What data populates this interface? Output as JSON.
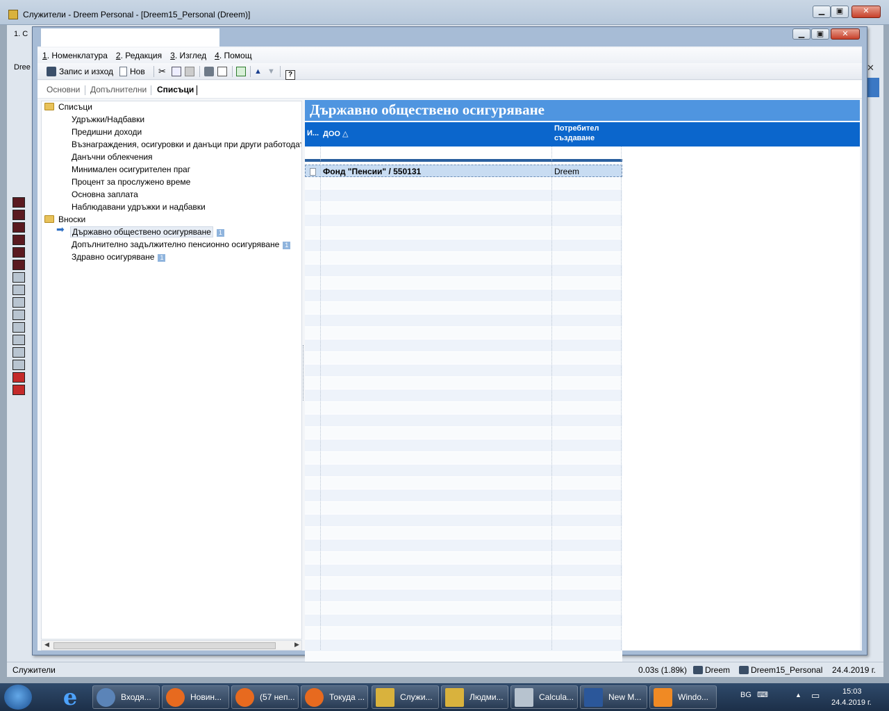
{
  "outer_window": {
    "title": "Служители - Dreem Personal - [Dreem15_Personal (Dreem)]",
    "ghost_menu_1": "1. С",
    "ghost_label": "Dree",
    "status": {
      "left": "Служители",
      "timing": "0.03s (1.89k)",
      "user": "Dreem",
      "database": "Dreem15_Personal",
      "date": "24.4.2019 г."
    }
  },
  "window_buttons": {
    "minimize": "▁",
    "maximize": "▣",
    "close": "✕"
  },
  "inner_window": {
    "menu": [
      {
        "num": "1",
        "label": ". Номенклатура"
      },
      {
        "num": "2",
        "label": ". Редакция"
      },
      {
        "num": "3",
        "label": ". Изглед"
      },
      {
        "num": "4",
        "label": ". Помощ"
      }
    ],
    "toolbar": {
      "save_exit": "Запис и изход",
      "new": "Нов"
    },
    "tabs": [
      "Основни",
      "Допълнителни",
      "Списъци"
    ],
    "tree": {
      "root_lists": "Списъци",
      "lists_items": [
        "Удръжки/Надбавки",
        "Предишни доходи",
        "Възнаграждения, осигуровки и данъци при други работодат",
        "Данъчни облекчения",
        "Минимален осигурителен праг",
        "Процент за прослужено време",
        "Основна заплата",
        "Наблюдавани удръжки и надбавки"
      ],
      "root_contrib": "Вноски",
      "contrib_items": [
        {
          "label": "Държавно обществено осигуряване",
          "count": "1"
        },
        {
          "label": "Допълнително задължително пенсионно осигуряване",
          "count": "1"
        },
        {
          "label": "Здравно осигуряване",
          "count": "1"
        }
      ]
    },
    "grid": {
      "title": "Държавно обществено осигуряване",
      "columns": {
        "c1": "И...",
        "c2": "ДОО",
        "c2_sort": "△",
        "c3_line1": "Потребител",
        "c3_line2": "създаване"
      },
      "rows": [
        {
          "name": "Фонд \"Пенсии\" / 550131",
          "user": "Dreem"
        }
      ]
    }
  },
  "taskbar": {
    "tasks": [
      "Входя...",
      "Новин...",
      "(57 неп...",
      "Токуда ...",
      "Служи...",
      "Людми...",
      "Calcula...",
      "New M...",
      "Windo..."
    ],
    "lang": "BG",
    "time": "15:03",
    "date": "24.4.2019 г."
  },
  "colors": {
    "grid_title_bg": "#4f95e0",
    "grid_header_bg": "#0b66cc",
    "selected_row": "#c8dcf2",
    "folder": "#e8c25a"
  }
}
